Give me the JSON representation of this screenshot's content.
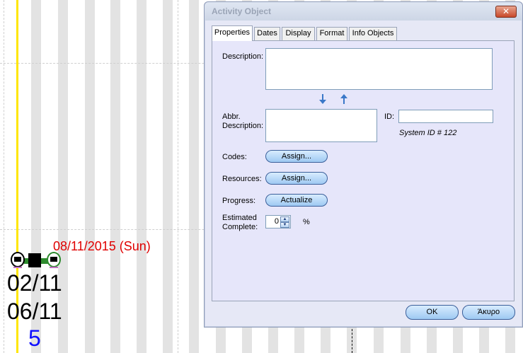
{
  "background": {
    "bar_date_label": "08/11/2015 (Sun)",
    "start_date": "02/11",
    "end_date": "06/11",
    "duration": "5",
    "colors": {
      "today_line": "#ffe600",
      "date_label": "#e00000",
      "duration": "#1010ff",
      "connector": "#2e8b2e"
    }
  },
  "dialog": {
    "title": "Activity Object",
    "close_icon": "close-icon",
    "tabs": [
      {
        "label": "Properties"
      },
      {
        "label": "Dates"
      },
      {
        "label": "Display"
      },
      {
        "label": "Format"
      },
      {
        "label": "Info Objects"
      }
    ],
    "properties": {
      "description_label": "Description:",
      "description_value": "",
      "abbr_label_line1": "Abbr.",
      "abbr_label_line2": "Description:",
      "abbr_value": "",
      "id_label": "ID:",
      "id_value": "",
      "system_id": "System ID # 122",
      "codes_label": "Codes:",
      "codes_button": "Assign...",
      "resources_label": "Resources:",
      "resources_button": "Assign...",
      "progress_label": "Progress:",
      "progress_button": "Actualize",
      "estimated_label_line1": "Estimated",
      "estimated_label_line2": "Complete:",
      "estimated_value": "0",
      "percent_sign": "%"
    },
    "buttons": {
      "ok": "OK",
      "cancel": "Άκυρο"
    }
  }
}
